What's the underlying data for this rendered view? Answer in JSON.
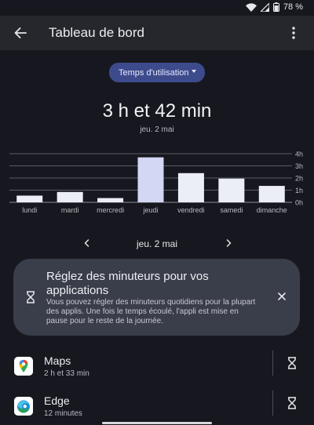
{
  "status": {
    "battery": "78 %"
  },
  "header": {
    "title": "Tableau de bord"
  },
  "filter": {
    "selected": "Temps d'utilisation"
  },
  "summary": {
    "total": "3 h et 42 min",
    "date": "jeu. 2 mai"
  },
  "chart_data": {
    "type": "bar",
    "categories": [
      "lundi",
      "mardi",
      "mercredi",
      "jeudi",
      "vendredi",
      "samedi",
      "dimanche"
    ],
    "values": [
      0.55,
      0.85,
      0.35,
      3.7,
      2.4,
      1.95,
      1.35
    ],
    "unit": "h",
    "yticks": [
      {
        "v": 0,
        "label": "0h"
      },
      {
        "v": 1,
        "label": "1h"
      },
      {
        "v": 2,
        "label": "2h"
      },
      {
        "v": 3,
        "label": "3h"
      },
      {
        "v": 4,
        "label": "4h"
      }
    ],
    "ylim": [
      0,
      4
    ],
    "highlight_index": 3,
    "grid": true,
    "colors": {
      "bar": "#eceef6",
      "highlight": "#d3d7f3",
      "grid": "#5a5b66",
      "label": "#b8b8c0"
    }
  },
  "daynav": {
    "label": "jeu. 2 mai"
  },
  "tip": {
    "title": "Réglez des minuteurs pour vos applications",
    "body": "Vous pouvez régler des minuteurs quotidiens pour la plupart des applis. Une fois le temps écoulé, l'appli est mise en pause pour le reste de la journée."
  },
  "apps": [
    {
      "name": "Maps",
      "time": "2 h et 33 min",
      "icon": "maps-icon"
    },
    {
      "name": "Edge",
      "time": "12 minutes",
      "icon": "edge-icon"
    }
  ]
}
